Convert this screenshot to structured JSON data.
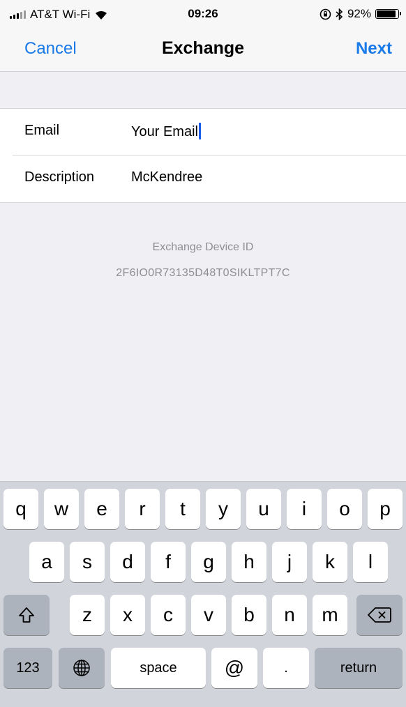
{
  "status_bar": {
    "carrier": "AT&T Wi-Fi",
    "time": "09:26",
    "battery_percent": "92%",
    "battery_level": 0.92,
    "icons": [
      "signal-icon",
      "wifi-icon",
      "orientation-lock-icon",
      "bluetooth-icon",
      "battery-icon"
    ]
  },
  "nav": {
    "cancel_label": "Cancel",
    "title": "Exchange",
    "next_label": "Next"
  },
  "form": {
    "email": {
      "label": "Email",
      "value": "Your Email"
    },
    "description": {
      "label": "Description",
      "value": "McKendree"
    }
  },
  "device": {
    "label": "Exchange Device ID",
    "id": "2F6IO0R73135D48T0SIKLTPT7C"
  },
  "keyboard": {
    "row1": [
      "q",
      "w",
      "e",
      "r",
      "t",
      "y",
      "u",
      "i",
      "o",
      "p"
    ],
    "row2": [
      "a",
      "s",
      "d",
      "f",
      "g",
      "h",
      "j",
      "k",
      "l"
    ],
    "row3": [
      "z",
      "x",
      "c",
      "v",
      "b",
      "n",
      "m"
    ],
    "numbers_label": "123",
    "space_label": "space",
    "at_label": "@",
    "dot_label": ".",
    "return_label": "return"
  },
  "colors": {
    "accent": "#1a7ae8",
    "background": "#efeff4",
    "keyboard": "#d1d4da",
    "function_key": "#acb3bd",
    "secondary_text": "#8e8e93"
  }
}
